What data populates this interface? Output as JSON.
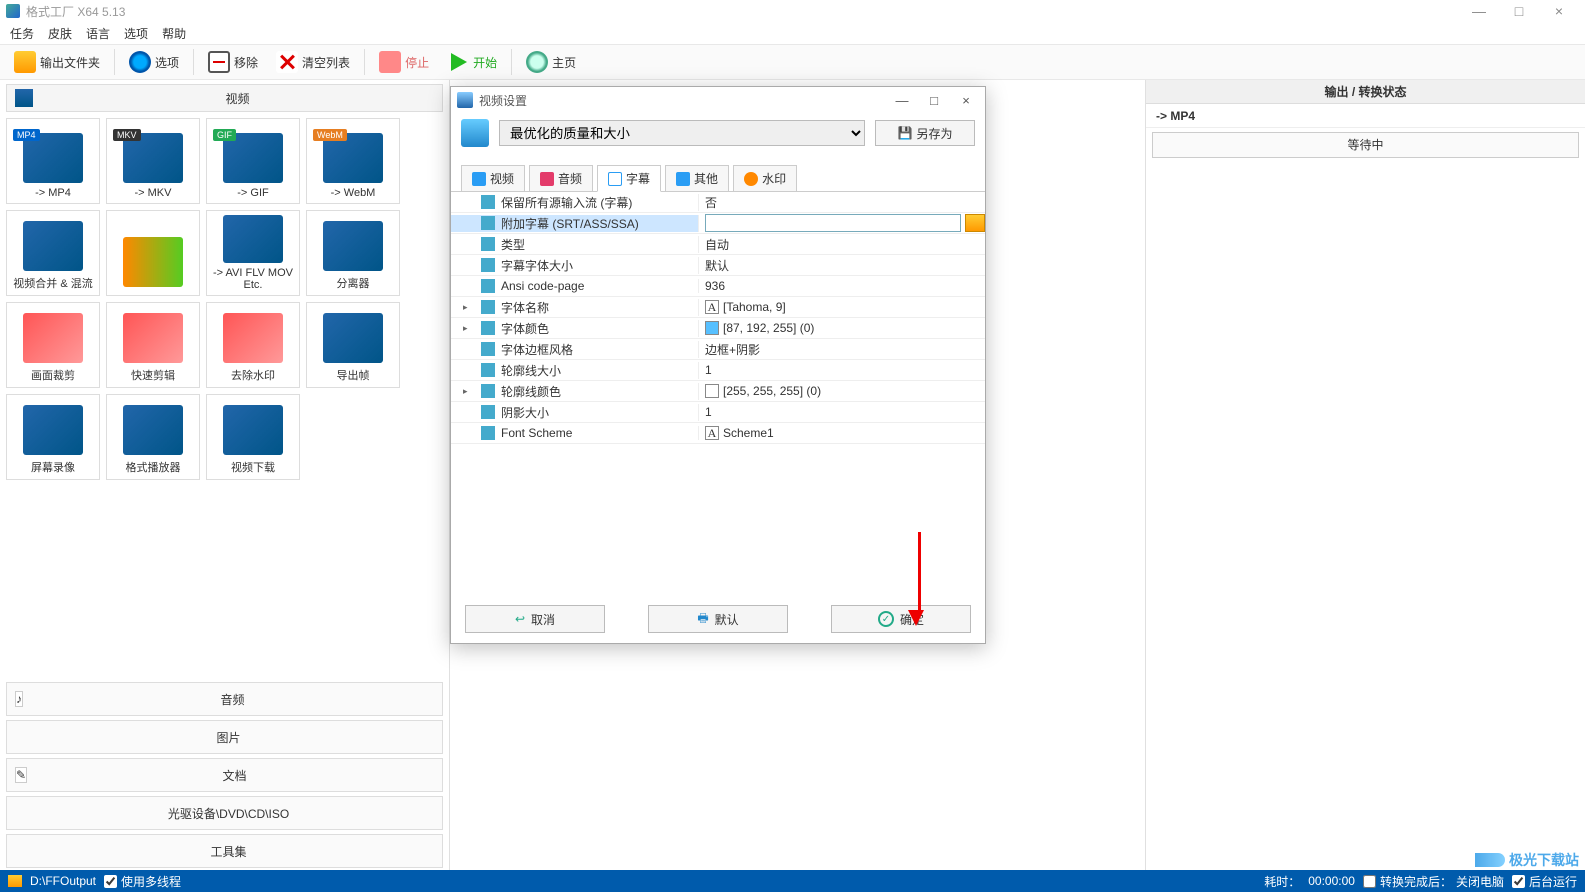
{
  "window": {
    "title": "格式工厂 X64 5.13"
  },
  "menu": [
    "任务",
    "皮肤",
    "语言",
    "选项",
    "帮助"
  ],
  "toolbar": {
    "output_folder": "输出文件夹",
    "options": "选项",
    "remove": "移除",
    "clear": "清空列表",
    "stop": "停止",
    "start": "开始",
    "home": "主页"
  },
  "left": {
    "cat_video": "视频",
    "tiles": [
      {
        "label": "-> MP4",
        "badge": "MP4",
        "bc": "#0066cc"
      },
      {
        "label": "-> MKV",
        "badge": "MKV",
        "bc": "#333"
      },
      {
        "label": "-> GIF",
        "badge": "GIF",
        "bc": "#22aa55"
      },
      {
        "label": "-> WebM",
        "badge": "WebM",
        "bc": "#e67e22"
      },
      {
        "label": "视频合并 & 混流"
      },
      {
        "label": ""
      },
      {
        "label": "-> AVI FLV MOV Etc."
      },
      {
        "label": "分离器"
      },
      {
        "label": "画面裁剪"
      },
      {
        "label": "快速剪辑"
      },
      {
        "label": "去除水印"
      },
      {
        "label": "导出帧"
      },
      {
        "label": "屏幕录像"
      },
      {
        "label": "格式播放器"
      },
      {
        "label": "视频下载"
      }
    ],
    "cat_audio": "音频",
    "cat_image": "图片",
    "cat_doc": "文档",
    "cat_disc": "光驱设备\\DVD\\CD\\ISO",
    "cat_tools": "工具集"
  },
  "right": {
    "header": "输出 / 转换状态",
    "row1": "-> MP4",
    "waiting": "等待中"
  },
  "dialog": {
    "title": "视频设置",
    "preset": "最优化的质量和大小",
    "save_as": "另存为",
    "tabs": {
      "video": "视频",
      "audio": "音频",
      "subtitle": "字幕",
      "other": "其他",
      "watermark": "水印"
    },
    "rows": [
      {
        "k": "保留所有源输入流 (字幕)",
        "v": "否",
        "exp": false
      },
      {
        "k": "附加字幕 (SRT/ASS/SSA)",
        "v": "",
        "sel": true,
        "browse": true
      },
      {
        "k": "类型",
        "v": "自动"
      },
      {
        "k": "字幕字体大小",
        "v": "默认"
      },
      {
        "k": "Ansi code-page",
        "v": "936"
      },
      {
        "k": "字体名称",
        "v": "[Tahoma, 9]",
        "exp": true,
        "leadicon": "A"
      },
      {
        "k": "字体颜色",
        "v": "[87, 192, 255] (0)",
        "exp": true,
        "swatch": "#57c0ff"
      },
      {
        "k": "字体边框风格",
        "v": "边框+阴影"
      },
      {
        "k": "轮廓线大小",
        "v": "1"
      },
      {
        "k": "轮廓线颜色",
        "v": "[255, 255, 255] (0)",
        "exp": true,
        "swatch": "#ffffff"
      },
      {
        "k": "阴影大小",
        "v": "1"
      },
      {
        "k": "Font Scheme",
        "v": "Scheme1",
        "leadicon": "A"
      }
    ],
    "btn_cancel": "取消",
    "btn_default": "默认",
    "btn_ok": "确定"
  },
  "statusbar": {
    "path": "D:\\FFOutput",
    "multithread": "使用多线程",
    "elapsed_label": "耗时：",
    "elapsed": "00:00:00",
    "after_label": "转换完成后：",
    "after_value": "关闭电脑",
    "bg_label": "后台运行"
  },
  "watermark": "极光下载站"
}
